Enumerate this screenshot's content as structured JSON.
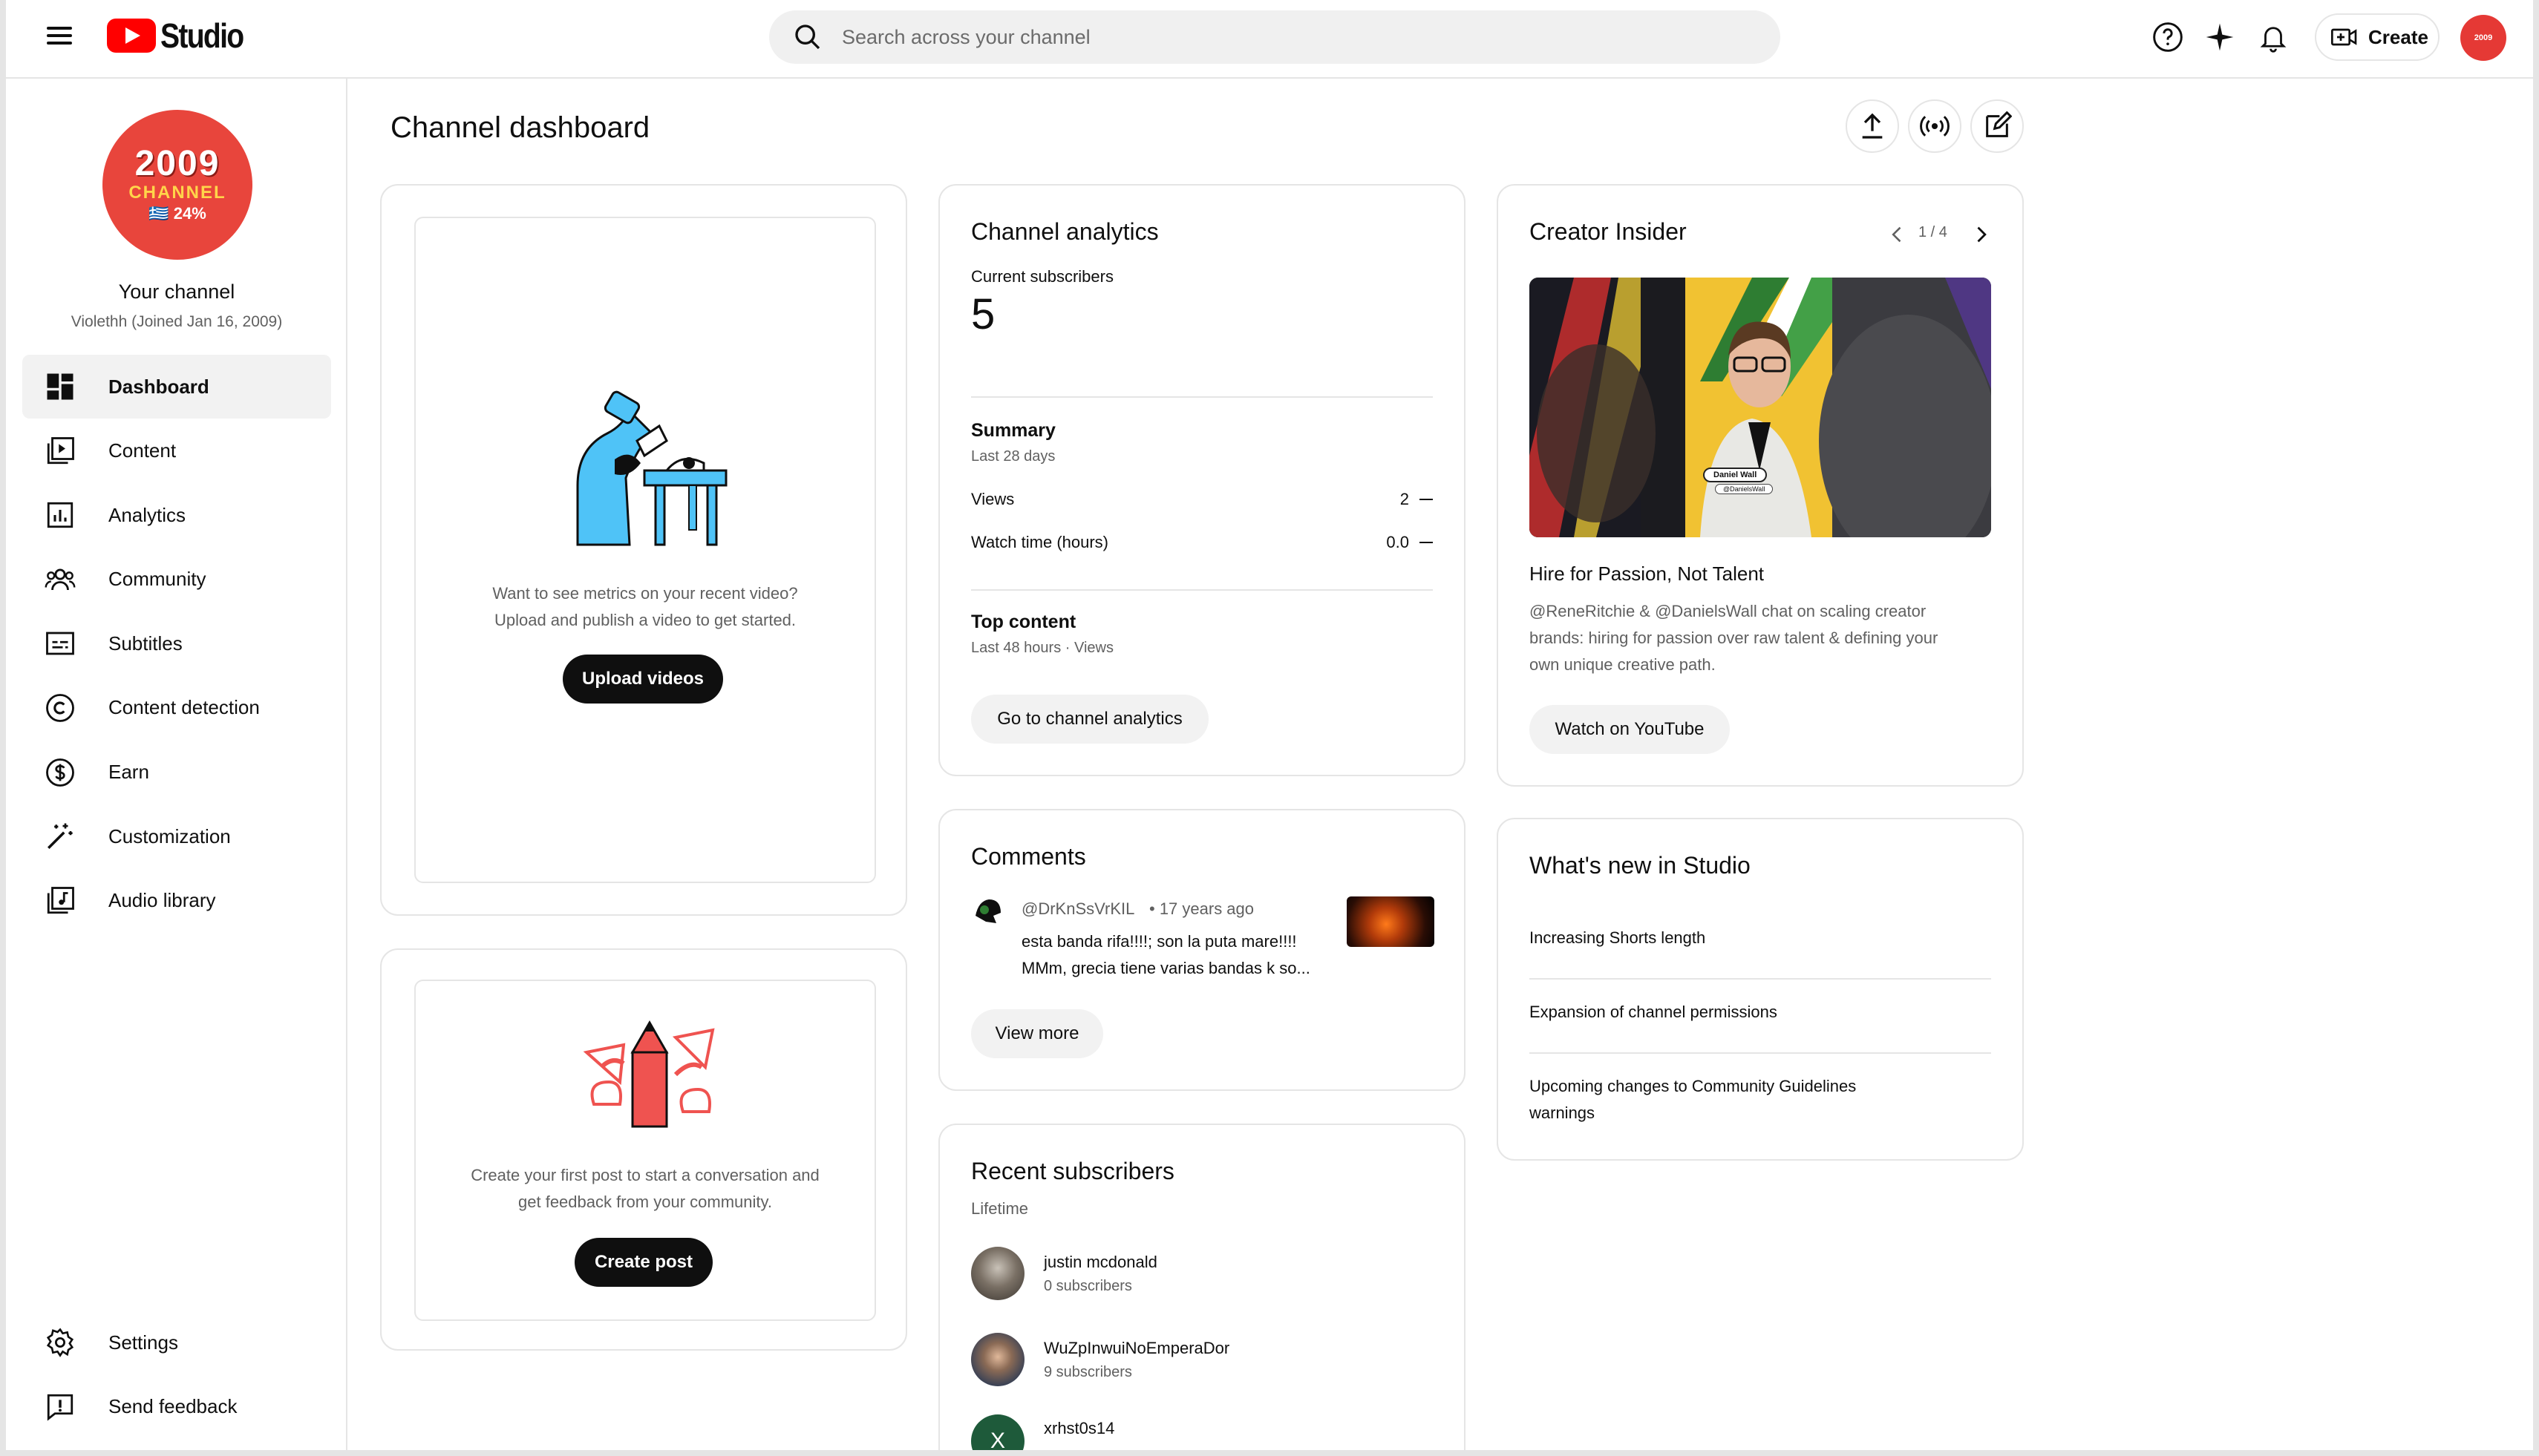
{
  "header": {
    "logo_text": "Studio",
    "search_placeholder": "Search across your channel",
    "create_label": "Create",
    "avatar_text": "2009"
  },
  "channel": {
    "avatar_year": "2009",
    "avatar_channel": "CHANNEL",
    "avatar_percent": "🇬🇷 24%",
    "name": "Your channel",
    "subtitle": "Violethh (Joined Jan 16, 2009)"
  },
  "sidebar": {
    "items": [
      {
        "label": "Dashboard",
        "icon": "dashboard-icon",
        "active": true
      },
      {
        "label": "Content",
        "icon": "content-icon"
      },
      {
        "label": "Analytics",
        "icon": "analytics-icon"
      },
      {
        "label": "Community",
        "icon": "community-icon"
      },
      {
        "label": "Subtitles",
        "icon": "subtitles-icon"
      },
      {
        "label": "Content detection",
        "icon": "copyright-icon"
      },
      {
        "label": "Earn",
        "icon": "dollar-icon"
      },
      {
        "label": "Customization",
        "icon": "magic-wand-icon"
      },
      {
        "label": "Audio library",
        "icon": "audio-library-icon"
      }
    ],
    "bottom": [
      {
        "label": "Settings",
        "icon": "gear-icon"
      },
      {
        "label": "Send feedback",
        "icon": "feedback-icon"
      }
    ]
  },
  "main": {
    "title": "Channel dashboard",
    "upload_card": {
      "text_line1": "Want to see metrics on your recent video?",
      "text_line2": "Upload and publish a video to get started.",
      "button": "Upload videos"
    },
    "post_card": {
      "text_line1": "Create your first post to start a conversation and",
      "text_line2": "get feedback from your community.",
      "button": "Create post"
    },
    "analytics": {
      "title": "Channel analytics",
      "current_subscribers_label": "Current subscribers",
      "current_subscribers": "5",
      "summary_title": "Summary",
      "summary_period": "Last 28 days",
      "rows": [
        {
          "label": "Views",
          "value": "2"
        },
        {
          "label": "Watch time (hours)",
          "value": "0.0"
        }
      ],
      "top_content_title": "Top content",
      "top_content_period": "Last 48 hours · Views",
      "button": "Go to channel analytics"
    },
    "comments": {
      "title": "Comments",
      "author": "@DrKnSsVrKIL",
      "time": "• 17 years ago",
      "text_line1": "esta banda rifa!!!!; son la puta mare!!!!",
      "text_line2": "MMm,  grecia tiene varias bandas k so...",
      "button": "View more"
    },
    "recent_subscribers": {
      "title": "Recent subscribers",
      "period": "Lifetime",
      "items": [
        {
          "name": "justin mcdonald",
          "count": "0 subscribers"
        },
        {
          "name": "WuZpInwuiNoEmperaDor",
          "count": "9 subscribers"
        },
        {
          "name": "xrhst0s14",
          "initial": "X"
        }
      ]
    },
    "creator_insider": {
      "title": "Creator Insider",
      "pager": "1 / 4",
      "thumb_name_tag": "Daniel Wall",
      "thumb_handle_tag": "@DanielsWall",
      "video_title": "Hire for Passion, Not Talent",
      "desc_line1": "@ReneRitchie & @DanielsWall chat on scaling creator",
      "desc_line2": "brands: hiring for passion over raw talent & defining your",
      "desc_line3": "own unique creative path.",
      "button": "Watch on YouTube"
    },
    "whats_new": {
      "title": "What's new in Studio",
      "items": [
        "Increasing Shorts length",
        "Expansion of channel permissions",
        "Upcoming changes to Community Guidelines warnings"
      ]
    }
  },
  "colors": {
    "brand_red": "#ff0000",
    "avatar_red": "#e8453c",
    "illustration_blue": "#4fc3f7",
    "illustration_red": "#ef5350"
  }
}
